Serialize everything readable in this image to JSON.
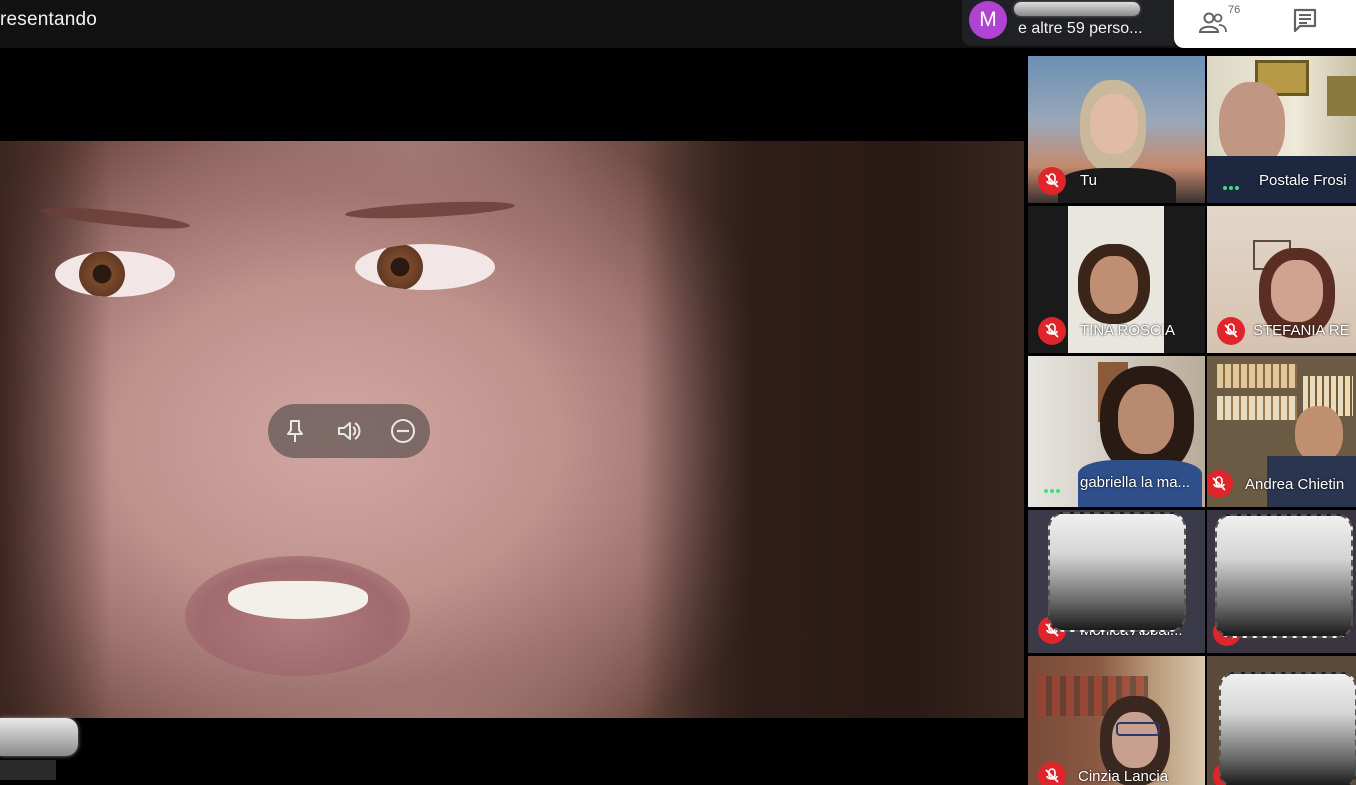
{
  "header": {
    "presenting_text": "resentando",
    "avatar_initial": "M",
    "others_text": "e altre 59 perso...",
    "people_count": "76",
    "avatar_color": "#b043d1"
  },
  "controls": {
    "pin_icon": "pin-icon",
    "volume_icon": "volume-icon",
    "remove_icon": "minus-circle-icon"
  },
  "participants": [
    {
      "name": "Tu",
      "muted": true
    },
    {
      "name": "Postale Frosi",
      "muted": false
    },
    {
      "name": "TINA ROSCIA",
      "muted": true
    },
    {
      "name": "STEFANIA RE",
      "muted": true
    },
    {
      "name": "gabriella la ma...",
      "muted": false
    },
    {
      "name": "Andrea Chietin",
      "muted": true
    },
    {
      "name": "Monica Abbal...",
      "muted": true
    },
    {
      "name": "",
      "muted": true
    },
    {
      "name": "Cinzia Lancia",
      "muted": true
    },
    {
      "name": "",
      "muted": true
    }
  ],
  "colors": {
    "mic_off": "#e0252a",
    "speaking_dots": "#3fe07a"
  }
}
